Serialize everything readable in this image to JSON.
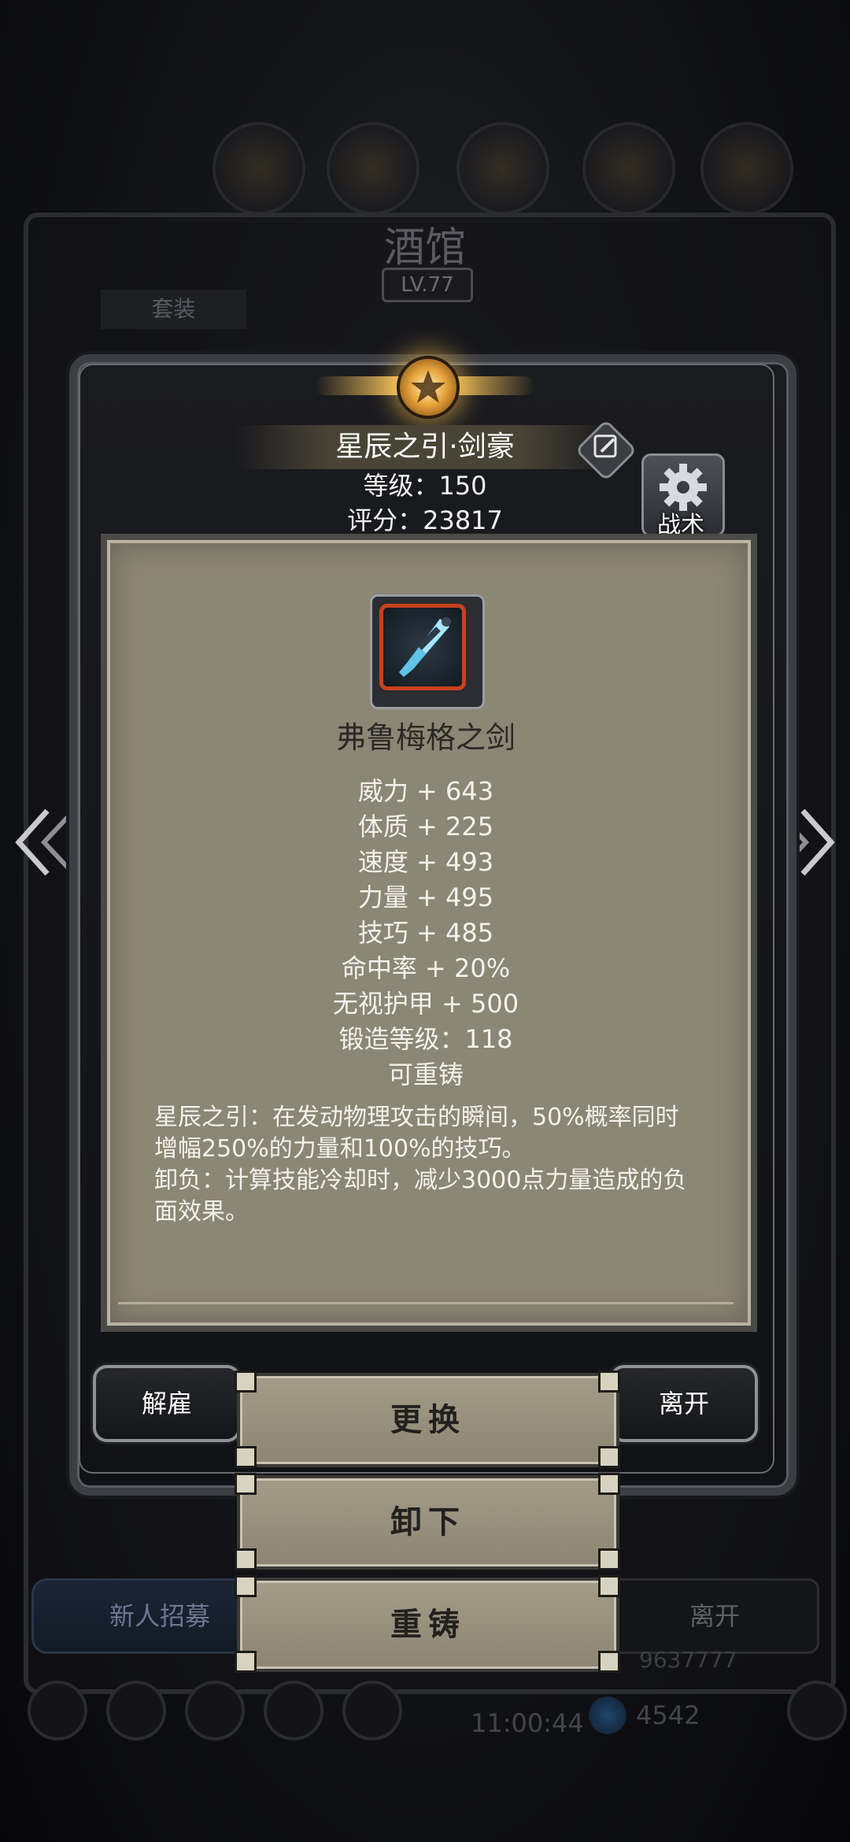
{
  "background": {
    "title": "酒馆",
    "level": "LV.77",
    "tab": "套装",
    "left_button": "新人招募",
    "right_button": "离开",
    "clock": "11:00:44",
    "gem_count": "4542",
    "gold": "9637777"
  },
  "hero": {
    "name": "星辰之引·剑豪",
    "level": "等级：150",
    "score": "评分：23817",
    "tactics_label": "战术"
  },
  "item": {
    "icon": "ice-sword-icon",
    "name": "弗鲁梅格之剑",
    "stats": [
      "威力 + 643",
      "体质 + 225",
      "速度 + 493",
      "力量 + 495",
      "技巧 + 485",
      "命中率 + 20%",
      "无视护甲 + 500",
      "锻造等级：118",
      "可重铸"
    ],
    "description": [
      "星辰之引：在发动物理攻击的瞬间，50%概率同时增幅250%的力量和100%的技巧。",
      "卸负：计算技能冷却时，减少3000点力量造成的负面效果。"
    ]
  },
  "actions": {
    "dismiss": "解雇",
    "leave": "离开",
    "replace": "更换",
    "unequip": "卸下",
    "reforge": "重铸"
  },
  "colors": {
    "parchment": "#8c8676",
    "emblem_gold": "#e7a43a",
    "item_frame_red": "#c8411d"
  }
}
